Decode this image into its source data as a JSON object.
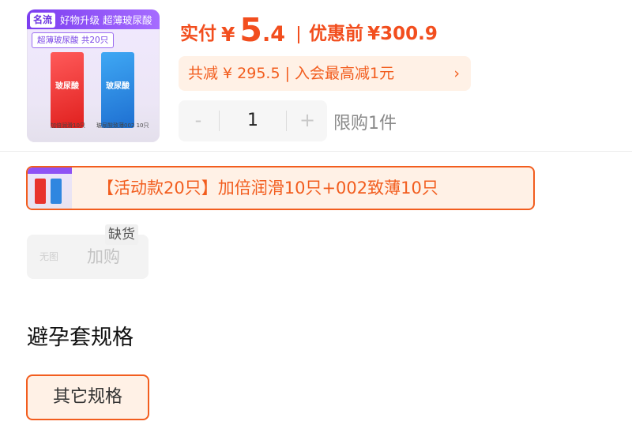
{
  "product": {
    "image": {
      "brand": "名流",
      "top_text": "好物升级 超薄玻尿酸",
      "sub_tag": "超薄玻尿酸 共20只",
      "box_left_text": "玻尿酸",
      "box_right_text": "玻尿酸",
      "caption_left": "加倍润滑10只",
      "caption_right": "玻尿酸致薄002 10只",
      "colors": {
        "top_bar": "#7c3ef0",
        "box_left": "#e0201e",
        "box_right": "#1e6fd1"
      }
    }
  },
  "price": {
    "actual_label": "实付",
    "currency": "¥",
    "actual_int": "5",
    "actual_dec": ".4",
    "original_label": "优惠前",
    "original_value": "¥300.9",
    "discount_text": "共减 ¥ 295.5 | 入会最高减1元",
    "discount_arrow": "›"
  },
  "quantity": {
    "minus": "-",
    "value": "1",
    "plus": "+",
    "limit_text": "限购1件"
  },
  "sku_options": [
    {
      "label": "【活动款20只】加倍润滑10只+002致薄10只",
      "selected": true
    },
    {
      "label": "加购",
      "image_placeholder": "无图",
      "badge": "缺货",
      "disabled": true
    }
  ],
  "spec_section": {
    "title": "避孕套规格",
    "options": [
      {
        "label": "其它规格",
        "selected": true
      }
    ]
  },
  "colors": {
    "accent": "#f25d1e",
    "accent_bg": "#fff1e6",
    "top_bar": "#7c3ef0"
  }
}
